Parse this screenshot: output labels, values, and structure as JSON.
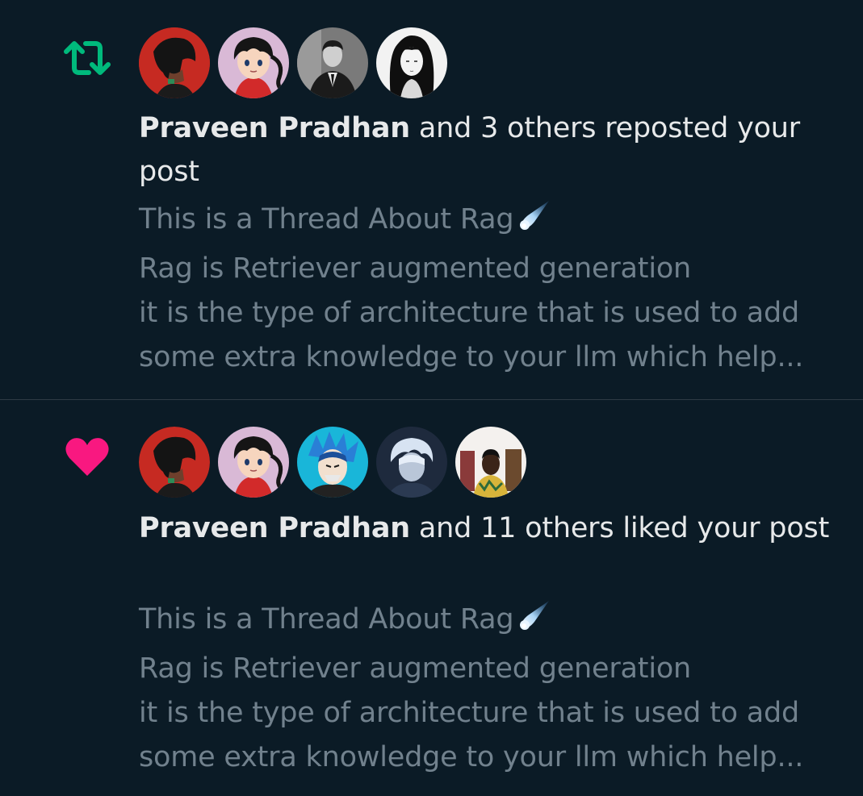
{
  "notifications": [
    {
      "type": "repost",
      "type_icon": "repost-icon",
      "icon_color": "#00ba7c",
      "avatars": [
        "avatar-dark-hair-red-bg",
        "avatar-anime-boy-red-shirt",
        "avatar-man-in-suit",
        "avatar-girl-black-hair"
      ],
      "actor": "Praveen Pradhan",
      "action_text": " and 3 others reposted your post",
      "preview": {
        "title": "This is a Thread About Rag",
        "emoji": "comet-icon",
        "line2": "Rag is Retriever augmented generation",
        "line3": "it is the type of architecture that is used to add",
        "line4": "some extra knowledge to your llm which help..."
      }
    },
    {
      "type": "like",
      "type_icon": "heart-icon",
      "icon_color": "#f91880",
      "avatars": [
        "avatar-dark-hair-red-bg",
        "avatar-anime-boy-red-shirt",
        "avatar-blue-hair-anime",
        "avatar-white-hair-anime",
        "avatar-man-yellow-shirt"
      ],
      "actor": "Praveen Pradhan",
      "action_text": " and 11 others liked your post",
      "preview": {
        "title": "This is a Thread About Rag",
        "emoji": "comet-icon",
        "line2": "Rag is Retriever augmented generation",
        "line3": "it is the type of architecture that is used to add",
        "line4": "some extra knowledge to your llm which help..."
      }
    }
  ]
}
